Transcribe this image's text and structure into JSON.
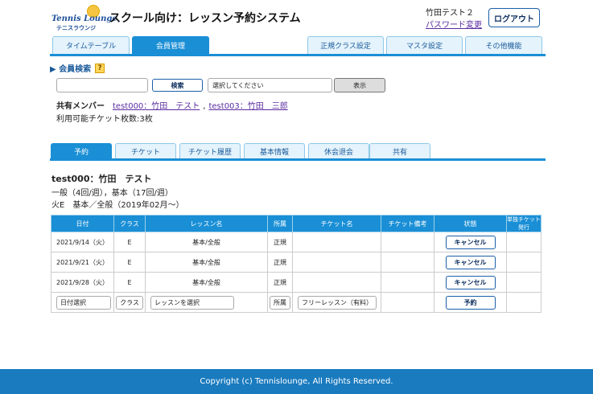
{
  "header": {
    "logo_text": "Tennis Lounge",
    "logo_sub": "テニスラウンジ",
    "app_title": "スクール向け：レッスン予約システム",
    "user_name": "竹田テスト２",
    "password_link": "パスワード変更",
    "logout_label": "ログアウト"
  },
  "main_tabs": {
    "timetable": "タイムテーブル",
    "member": "会員管理",
    "regular_class": "正規クラス設定",
    "master": "マスタ設定",
    "other": "その他機能"
  },
  "member_search": {
    "heading": "▶ 会員検索",
    "help": "?",
    "input_value": "",
    "search_label": "検索",
    "select_value": "選択してください",
    "show_label": "表示",
    "shared_label": "共有メンバー",
    "shared_members": [
      "test000：竹田　テスト",
      "test003：竹田　三郎"
    ],
    "separator": ",",
    "ticket_count": "利用可能チケット枚数:3枚"
  },
  "sub_tabs": {
    "reserve": "予約",
    "ticket": "チケット",
    "ticket_history": "チケット履歴",
    "basic_info": "基本情報",
    "suspend": "休会退会",
    "share": "共有"
  },
  "member": {
    "id_name": "test000：竹田　テスト",
    "plan1": "一般（4回/週），基本（17回/週）",
    "plan2": "火E　基本／全般（2019年02月～）"
  },
  "table": {
    "headers": [
      "日付",
      "クラス",
      "レッスン名",
      "所属",
      "チケット名",
      "チケット備考",
      "状態",
      "単独チケット発行"
    ],
    "rows": [
      {
        "date": "2021/9/14（火）",
        "class": "E",
        "lesson": "基本/全般",
        "belong": "正規",
        "ticket": "",
        "note": "",
        "action": "キャンセル",
        "single": ""
      },
      {
        "date": "2021/9/21（火）",
        "class": "E",
        "lesson": "基本/全般",
        "belong": "正規",
        "ticket": "",
        "note": "",
        "action": "キャンセル",
        "single": ""
      },
      {
        "date": "2021/9/28（火）",
        "class": "E",
        "lesson": "基本/全般",
        "belong": "正規",
        "ticket": "",
        "note": "",
        "action": "キャンセル",
        "single": ""
      }
    ],
    "new_row": {
      "date": "日付選択",
      "class": "クラス",
      "lesson": "レッスンを選択",
      "belong": "所属",
      "ticket": "フリーレッスン（有料）",
      "action": "予約"
    }
  },
  "footer": {
    "copyright": "Copyright (c) Tennislounge, All Rights Reserved."
  },
  "colors": {
    "primary": "#1a8fd6",
    "footer": "#1a7bbf",
    "tab_inactive": "#e4f3fc",
    "link": "#5a2ca0"
  }
}
